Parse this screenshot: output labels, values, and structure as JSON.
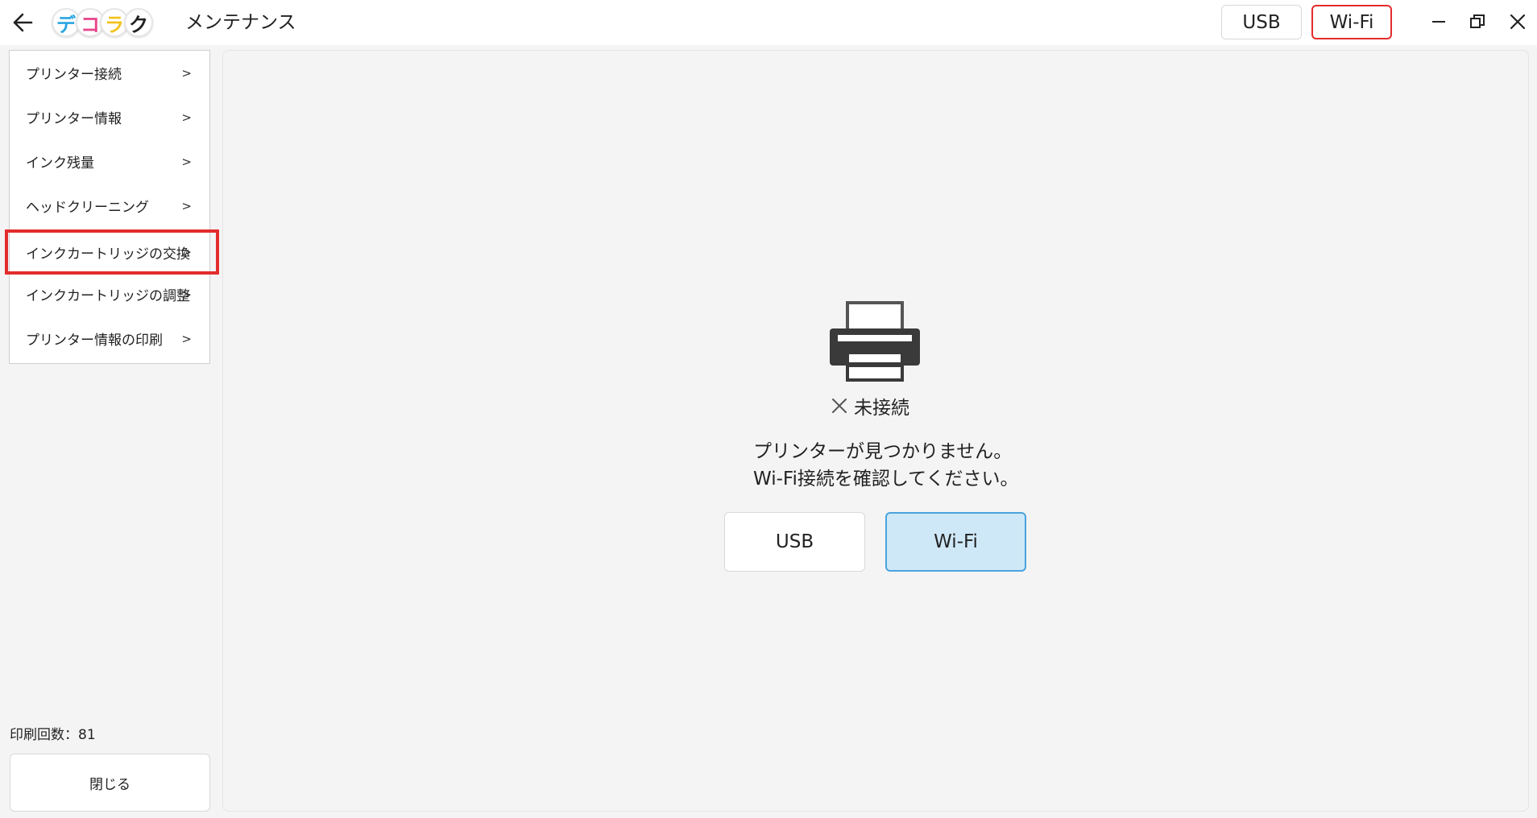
{
  "titlebar": {
    "logo_chars": [
      "デ",
      "コ",
      "ラ",
      "ク"
    ],
    "logo_colors": [
      "#2aa6e0",
      "#e8458b",
      "#f2c21b",
      "#222222"
    ],
    "title": "メンテナンス",
    "usb_label": "USB",
    "wifi_label": "Wi-Fi",
    "icons": {
      "back": "arrow-left-icon",
      "minimize": "minimize-icon",
      "restore": "restore-icon",
      "close": "close-icon"
    }
  },
  "sidebar": {
    "items": [
      {
        "label": "プリンター接続",
        "chevron": ">"
      },
      {
        "label": "プリンター情報",
        "chevron": ">"
      },
      {
        "label": "インク残量",
        "chevron": ">"
      },
      {
        "label": "ヘッドクリーニング",
        "chevron": ">"
      },
      {
        "label": "インクカートリッジの交換",
        "chevron": ">"
      },
      {
        "label": "インクカートリッジの調整",
        "chevron": ">"
      },
      {
        "label": "プリンター情報の印刷",
        "chevron": ">"
      }
    ],
    "print_count": "印刷回数：81",
    "close_label": "閉じる"
  },
  "main": {
    "status_label": "未接続",
    "message_line1": "プリンターが見つかりません。",
    "message_line2": "Wi-Fi接続を確認してください。",
    "usb_button": "USB",
    "wifi_button": "Wi-Fi"
  },
  "colors": {
    "highlight": "#e32c2c",
    "selected_bg": "#cfe8f7",
    "selected_border": "#4aa3dd",
    "panel_bg": "#f4f4f4"
  }
}
